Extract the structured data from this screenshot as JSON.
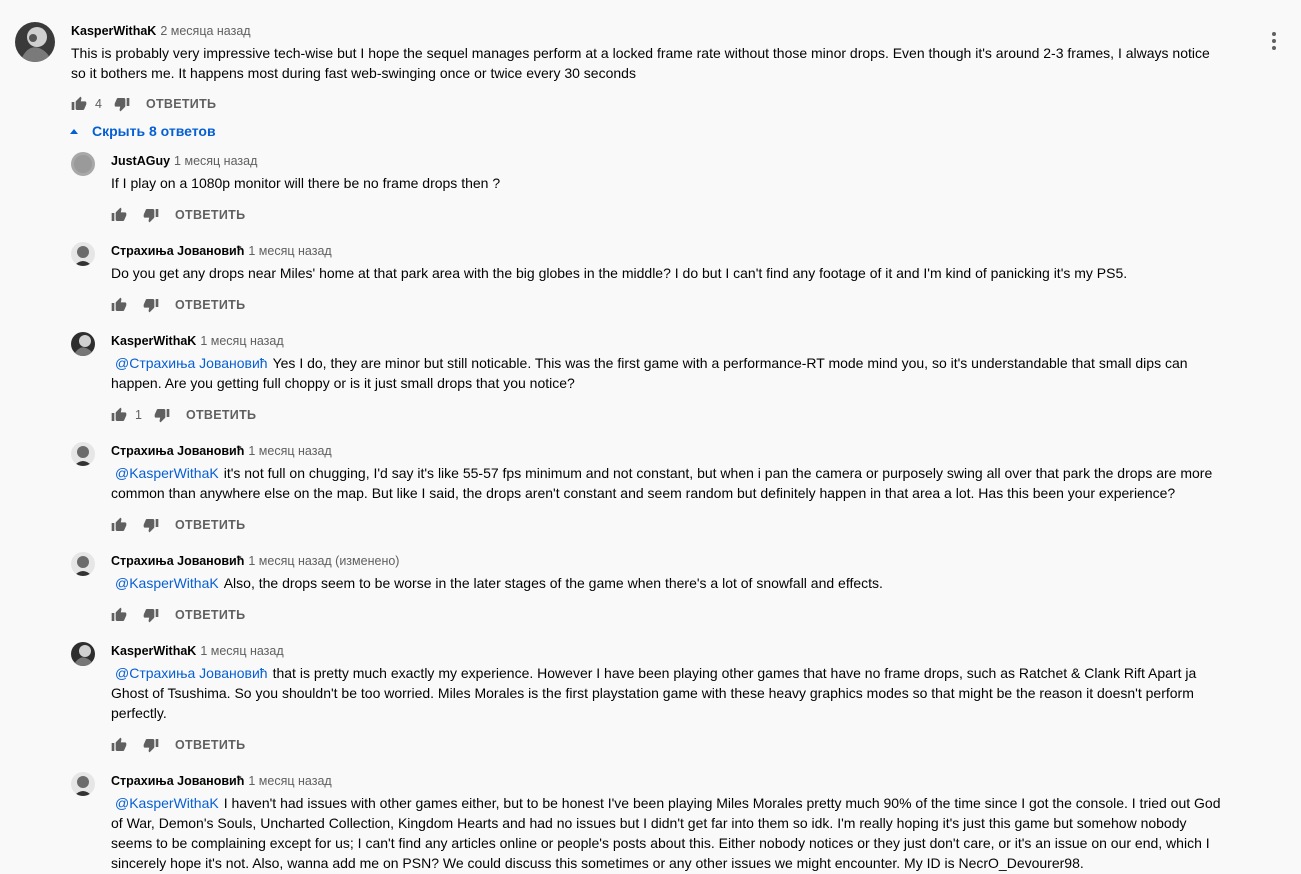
{
  "top": {
    "author": "KasperWithaK",
    "time": "2 месяца назад",
    "text_l1": "This is probably very impressive tech-wise but I hope the sequel manages perform at a locked frame rate without those minor drops. Even though it's around 2-3 frames, I always notice",
    "text_l2": "so it bothers me. It happens most during fast web-swinging once or twice every 30 seconds",
    "likes": "4",
    "reply_label": "ОТВЕТИТЬ"
  },
  "toggle_label": "Скрыть 8 ответов",
  "replies": [
    {
      "author": "JustAGuy",
      "time": "1 месяц назад",
      "mention": "",
      "text_l1": "If I play on a 1080p monitor will there be no frame drops then ?",
      "text_l2": "",
      "text_l3": "",
      "text_l4": "",
      "likes": "",
      "reply_label": "ОТВЕТИТЬ"
    },
    {
      "author": "Страхиња Јовановић",
      "time": "1 месяц назад",
      "mention": "",
      "text_l1": "Do you get any drops near Miles' home at that park area with the big globes in the middle? I do but I can't find any footage of it and I'm kind of panicking it's my PS5.",
      "text_l2": "",
      "text_l3": "",
      "text_l4": "",
      "likes": "",
      "reply_label": "ОТВЕТИТЬ"
    },
    {
      "author": "KasperWithaK",
      "time": "1 месяц назад",
      "mention": "@Страхиња Јовановић",
      "text_l1": "Yes I do, they are minor but still noticable. This was the first game with a performance-RT mode mind you, so it's understandable that small dips can",
      "text_l2": "happen. Are you getting full choppy or is it just small drops that you notice?",
      "text_l3": "",
      "text_l4": "",
      "likes": "1",
      "reply_label": "ОТВЕТИТЬ"
    },
    {
      "author": "Страхиња Јовановић",
      "time": "1 месяц назад",
      "mention": "@KasperWithaK",
      "text_l1": "it's not full on chugging, I'd say it's like 55-57 fps minimum and not constant, but when i pan the camera or purposely swing all over that park the drops are more",
      "text_l2": "common than anywhere else on the map. But like I said, the drops aren't constant and seem random but definitely happen in that area a lot. Has this been your experience?",
      "text_l3": "",
      "text_l4": "",
      "likes": "",
      "reply_label": "ОТВЕТИТЬ"
    },
    {
      "author": "Страхиња Јовановић",
      "time": "1 месяц назад (изменено)",
      "mention": "@KasperWithaK",
      "text_l1": "Also, the drops seem to be worse in the later stages of the game when there's a lot of snowfall and effects.",
      "text_l2": "",
      "text_l3": "",
      "text_l4": "",
      "likes": "",
      "reply_label": "ОТВЕТИТЬ"
    },
    {
      "author": "KasperWithaK",
      "time": "1 месяц назад",
      "mention": "@Страхиња Јовановић",
      "text_l1": "that is pretty much exactly my experience. However I have been playing other games that have no frame drops, such as Ratchet & Clank Rift Apart ja",
      "text_l2": "Ghost of Tsushima. So you shouldn't be too worried. Miles Morales is the first playstation game with these heavy graphics modes so that might be the reason it doesn't perform",
      "text_l3": "perfectly.",
      "text_l4": "",
      "likes": "",
      "reply_label": "ОТВЕТИТЬ"
    },
    {
      "author": "Страхиња Јовановић",
      "time": "1 месяц назад",
      "mention": "@KasperWithaK",
      "text_l1": "I haven't had issues with other games either, but to be honest I've been playing Miles Morales pretty much 90% of the time since I got the console. I tried out God",
      "text_l2": "of War, Demon's Souls, Uncharted Collection, Kingdom Hearts and had no issues but I didn't get far into them so idk. I'm really hoping it's just this game but somehow nobody",
      "text_l3": "seems to be complaining except for us; I can't find any articles online or people's posts about this. Either nobody notices or they just don't care, or it's an issue on our end, which I",
      "text_l4": "sincerely hope it's not. Also, wanna add me on PSN? We could discuss this sometimes or any other issues we might encounter. My ID is NecrO_Devourer98.",
      "likes": "",
      "reply_label": ""
    }
  ]
}
